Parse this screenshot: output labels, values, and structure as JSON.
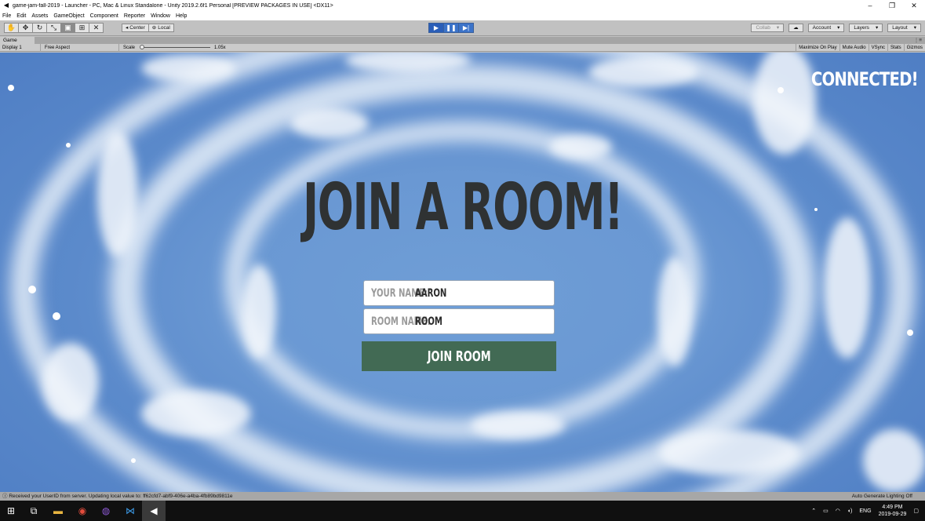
{
  "window": {
    "title": "game-jam-fall-2019 - Launcher - PC, Mac & Linux Standalone - Unity 2019.2.6f1 Personal [PREVIEW PACKAGES IN USE] <DX11>",
    "app_icon": "unity-logo-icon",
    "controls": {
      "minimize": "–",
      "restore": "❐",
      "close": "✕"
    }
  },
  "menu": [
    "File",
    "Edit",
    "Assets",
    "GameObject",
    "Component",
    "Reporter",
    "Window",
    "Help"
  ],
  "toolbar": {
    "tools": [
      {
        "name": "hand-tool-icon",
        "glyph": "✋"
      },
      {
        "name": "move-tool-icon",
        "glyph": "✥"
      },
      {
        "name": "rotate-tool-icon",
        "glyph": "↻"
      },
      {
        "name": "scale-tool-icon",
        "glyph": "⤡"
      },
      {
        "name": "rect-tool-icon",
        "glyph": "▣"
      },
      {
        "name": "transform-tool-icon",
        "glyph": "⊞"
      },
      {
        "name": "custom-tool-icon",
        "glyph": "✕"
      }
    ],
    "pivot": "Center",
    "space": "Local",
    "play": "▶",
    "pause": "❚❚",
    "step": "▶|",
    "collab": "Collab",
    "cloud_icon": "☁",
    "account": "Account",
    "layers": "Layers",
    "layout": "Layout",
    "dropdown_glyph": "▾"
  },
  "game_tab": {
    "label": "Game",
    "menu_glyph": "⋮≡"
  },
  "game_toolbar": {
    "display": "Display 1",
    "aspect": "Free Aspect",
    "scale_label": "Scale",
    "scale_value": "1.05x",
    "maximize_on_play": "Maximize On Play",
    "mute_audio": "Mute Audio",
    "vsync": "VSync",
    "stats": "Stats",
    "gizmos": "Gizmos"
  },
  "game": {
    "status": "CONNECTED!",
    "heading": "JOIN A ROOM!",
    "name_label": "YOUR NAME:",
    "name_value": "AARON",
    "room_label": "ROOM NAME:",
    "room_value": "ROOM",
    "join_button": "JOIN ROOM"
  },
  "statusbar": {
    "message": "Received your UserID from server. Updating local value to: ff62cfd7-abf9-406e-a4ba-4fb89bd9811e",
    "right": "Auto Generate Lighting Off"
  },
  "taskbar": {
    "language": "ENG",
    "time": "4:49 PM",
    "date": "2019-09-29"
  },
  "colors": {
    "sky": "#6a98d3",
    "heading": "#2f3233",
    "join_button": "#426a54",
    "play_active": "#2a5eb8"
  }
}
